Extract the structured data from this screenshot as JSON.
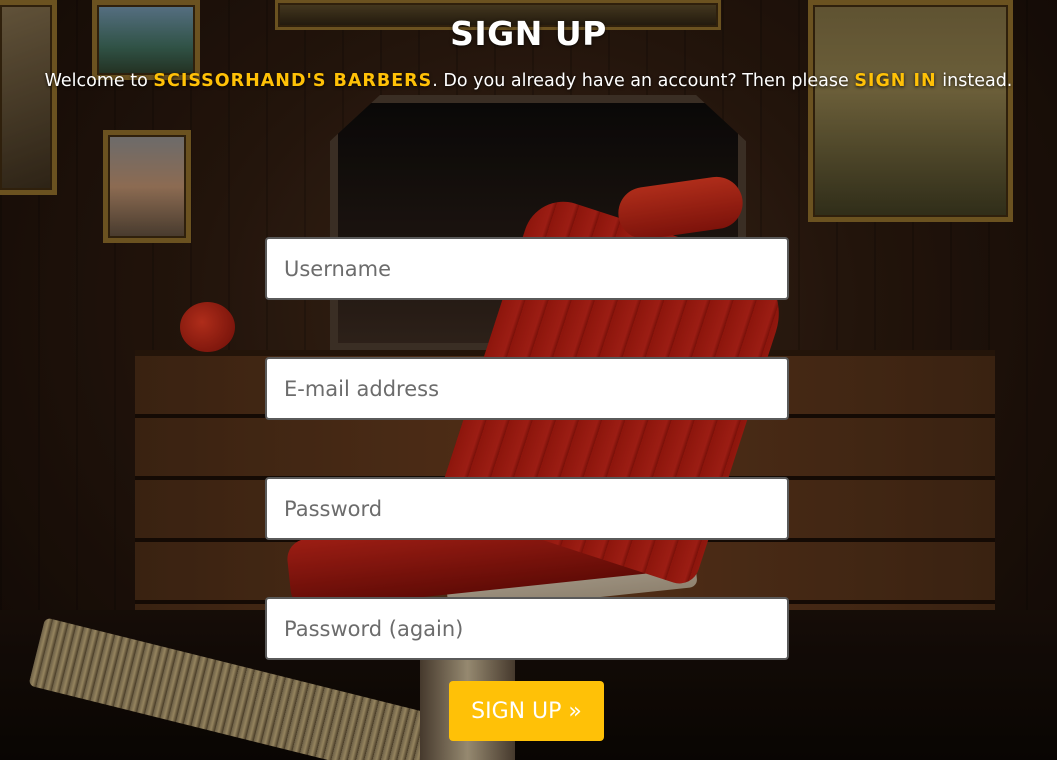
{
  "page": {
    "title": "SIGN UP"
  },
  "welcome": {
    "prefix": "Welcome to ",
    "brand": "SCISSORHAND'S BARBERS",
    "middle": ". Do you already have an account? Then please ",
    "signin_link": "SIGN IN",
    "suffix": " instead."
  },
  "form": {
    "username_placeholder": "Username",
    "email_placeholder": "E-mail address",
    "password_placeholder": "Password",
    "password_again_placeholder": "Password (again)",
    "submit_label": "SIGN UP »"
  },
  "colors": {
    "accent": "#ffc107",
    "text": "#ffffff",
    "input_bg": "#ffffff"
  }
}
